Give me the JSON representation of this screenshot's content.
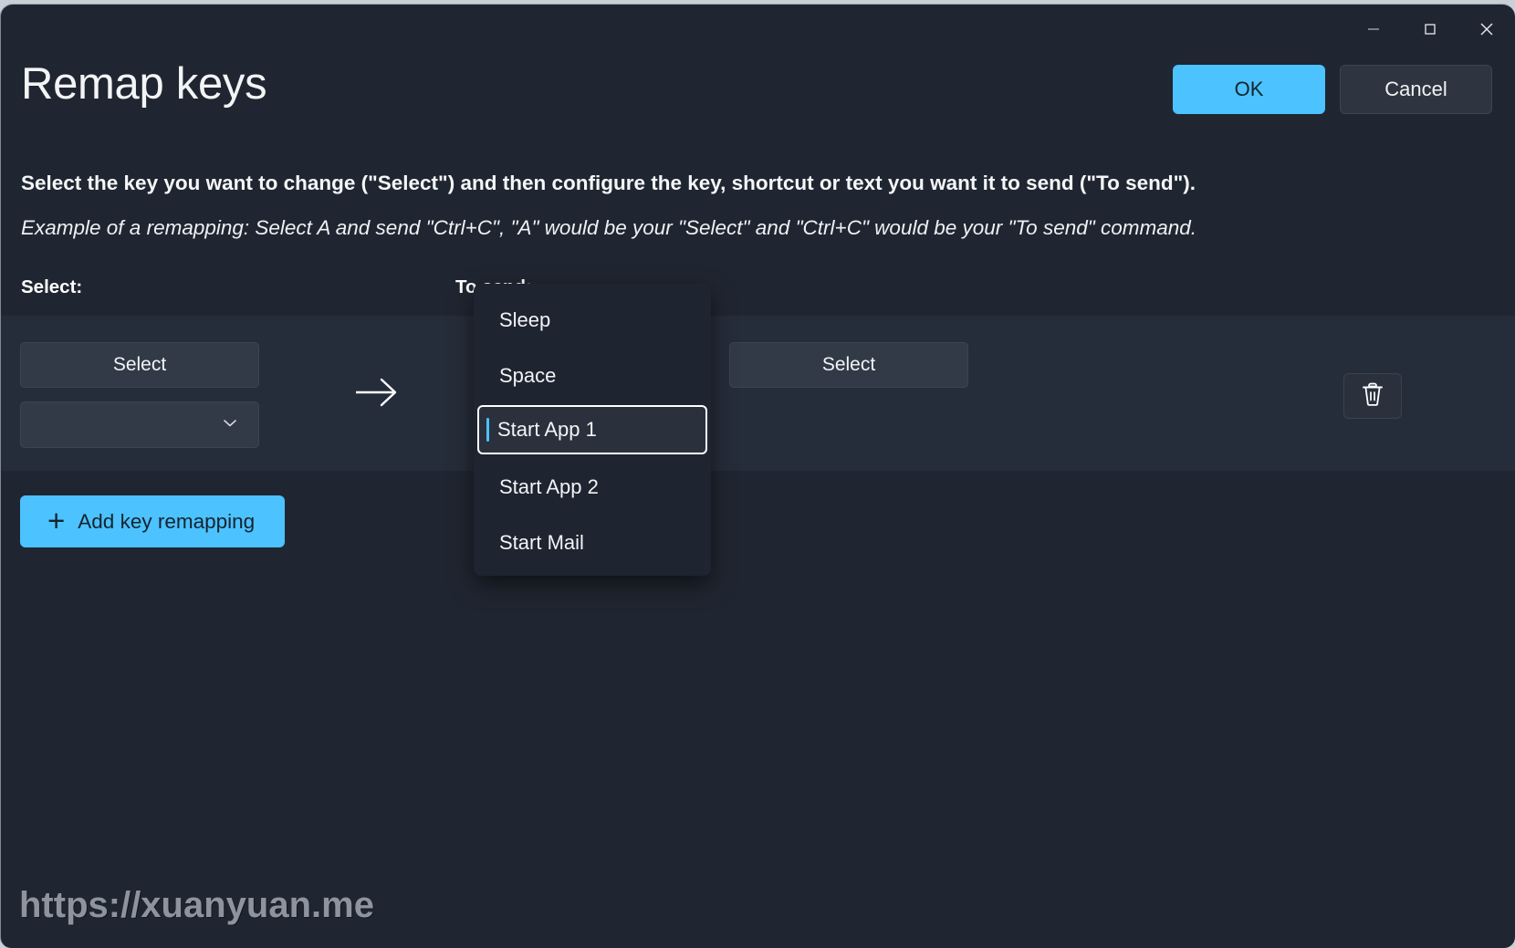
{
  "window": {
    "title": "Remap keys",
    "caption_buttons": [
      {
        "name": "minimize",
        "glyph": "minimize-icon"
      },
      {
        "name": "maximize",
        "glyph": "maximize-icon"
      },
      {
        "name": "close",
        "glyph": "close-icon"
      }
    ]
  },
  "header": {
    "ok_label": "OK",
    "cancel_label": "Cancel"
  },
  "description": {
    "line1": "Select the key you want to change (\"Select\") and then configure the key, shortcut or text you want it to send (\"To send\").",
    "line2": "Example of a remapping: Select A and send \"Ctrl+C\", \"A\" would be your \"Select\" and \"Ctrl+C\" would be your \"To send\" command."
  },
  "columns": {
    "select_label": "Select:",
    "to_send_label": "To send:"
  },
  "remap_row": {
    "select_key_button": "Select",
    "select_key_dropdown_value": "",
    "arrow_icon": "arrow-right-icon",
    "to_send_button": "Select",
    "delete_icon": "trash-icon"
  },
  "add_button": {
    "label": "Add key remapping",
    "icon": "plus-icon"
  },
  "key_dropdown": {
    "open": true,
    "selected_index": 2,
    "items": [
      {
        "label": "Sleep"
      },
      {
        "label": "Space"
      },
      {
        "label": "Start App 1"
      },
      {
        "label": "Start App 2"
      },
      {
        "label": "Start Mail"
      }
    ]
  },
  "watermark": {
    "text": "https://xuanyuan.me"
  },
  "colors": {
    "accent": "#4cc2ff",
    "window_bg": "#202631",
    "row_bg": "#262d3a",
    "control_bg": "#333a47",
    "dropdown_bg": "#1e2430"
  }
}
